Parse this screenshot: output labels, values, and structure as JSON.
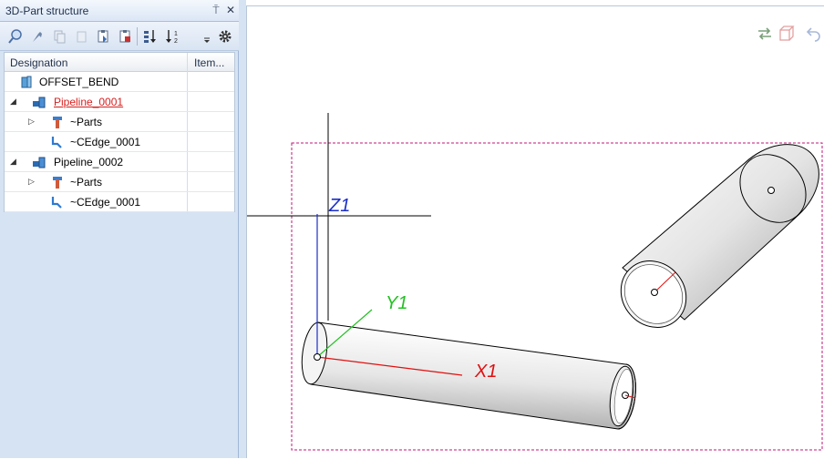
{
  "panel": {
    "title": "3D-Part structure",
    "pin_glyph": "⍑",
    "close_glyph": "✕",
    "toolbar": [
      {
        "name": "find-icon"
      },
      {
        "name": "wrench-icon"
      },
      {
        "name": "copy-icon"
      },
      {
        "name": "cut-icon"
      },
      {
        "name": "paste-icon"
      },
      {
        "name": "paste-special-icon"
      },
      {
        "name": "sort-ascending-icon"
      },
      {
        "name": "sort-descending-icon"
      },
      {
        "name": "dropdown-icon"
      },
      {
        "name": "gear-icon"
      }
    ],
    "columns": {
      "designation": "Designation",
      "item": "Item..."
    },
    "rows": [
      {
        "label": "OFFSET_BEND",
        "level": 0,
        "icon": "assembly-icon",
        "expander": ""
      },
      {
        "label": "Pipeline_0001",
        "level": 0,
        "icon": "pipeline-icon",
        "expander": "◢",
        "active": true
      },
      {
        "label": "~Parts",
        "level": 1,
        "icon": "parts-icon",
        "expander": "▷"
      },
      {
        "label": "~CEdge_0001",
        "level": 1,
        "icon": "edge-icon",
        "expander": ""
      },
      {
        "label": "Pipeline_0002",
        "level": 0,
        "icon": "pipeline-icon",
        "expander": "◢"
      },
      {
        "label": "~Parts",
        "level": 1,
        "icon": "parts-icon",
        "expander": "▷"
      },
      {
        "label": "~CEdge_0001",
        "level": 1,
        "icon": "edge-icon",
        "expander": ""
      }
    ]
  },
  "viewport": {
    "axes": {
      "x": "X1",
      "y": "Y1",
      "z": "Z1"
    },
    "colors": {
      "x": "#e01010",
      "y": "#22c022",
      "z": "#1a2ec8",
      "selection": "#c0157a"
    },
    "buttons": [
      {
        "name": "swap-icon"
      },
      {
        "name": "cube-icon"
      },
      {
        "name": "undo-icon"
      }
    ]
  }
}
